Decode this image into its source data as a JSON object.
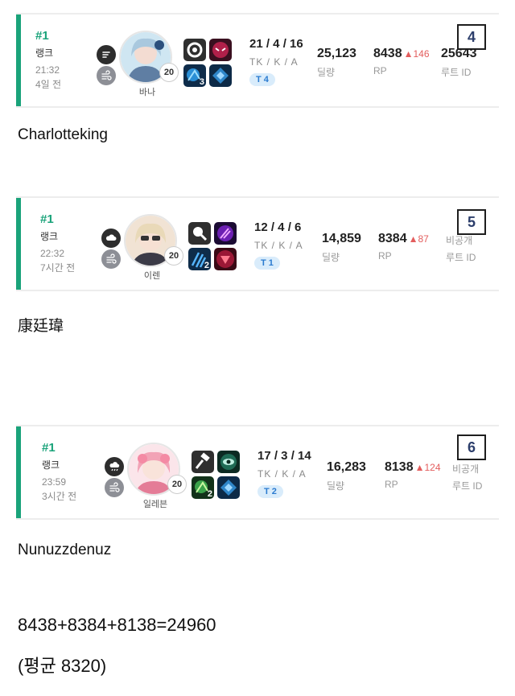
{
  "cards": [
    {
      "index": "4",
      "rank": "#1",
      "rank_label": "랭크",
      "time": "21:32",
      "ago": "4일 전",
      "weather_icons": [
        "wind-flag-icon",
        "haze-icon"
      ],
      "character": "바나",
      "level": "20",
      "items": [
        "gear-ring-icon",
        "demon-mask-icon",
        "blue-burst-icon",
        "blue-diamond-icon"
      ],
      "item_stack": "3",
      "kda": "21 / 4 / 16",
      "kda_label": "TK / K / A",
      "tier": "T 4",
      "damage": "25,123",
      "damage_label": "딜량",
      "rp": "8438",
      "rp_delta": "▲146",
      "rp_label": "RP",
      "root_id": "25643",
      "root_label": "루트 ID",
      "caption": "Charlotteking"
    },
    {
      "index": "5",
      "rank": "#1",
      "rank_label": "랭크",
      "time": "22:32",
      "ago": "7시간 전",
      "weather_icons": [
        "cloud-icon",
        "haze-icon"
      ],
      "character": "이렌",
      "level": "20",
      "items": [
        "magnifier-icon",
        "purple-spark-icon",
        "blue-claw-icon",
        "red-triangle-icon"
      ],
      "item_stack": "2",
      "kda": "12 / 4 / 6",
      "kda_label": "TK / K / A",
      "tier": "T 1",
      "damage": "14,859",
      "damage_label": "딜량",
      "rp": "8384",
      "rp_delta": "▲87",
      "rp_label": "RP",
      "root_id": "비공개",
      "root_label": "루트 ID",
      "caption": "康廷瑋"
    },
    {
      "index": "6",
      "rank": "#1",
      "rank_label": "랭크",
      "time": "23:59",
      "ago": "3시간 전",
      "weather_icons": [
        "rain-cloud-icon",
        "haze-icon"
      ],
      "character": "일레븐",
      "level": "20",
      "items": [
        "hammer-icon",
        "green-eye-icon",
        "green-burst-icon",
        "blue-diamond-icon"
      ],
      "item_stack": "2",
      "kda": "17 / 3 / 14",
      "kda_label": "TK / K / A",
      "tier": "T 2",
      "damage": "16,283",
      "damage_label": "딜량",
      "rp": "8138",
      "rp_delta": "▲124",
      "rp_label": "RP",
      "root_id": "비공개",
      "root_label": "루트 ID",
      "caption": "Nunuzzdenuz"
    }
  ],
  "summary": {
    "sum_line": "8438+8384+8138=24960",
    "avg_line": "(평균 8320)"
  },
  "colors": {
    "accent": "#1aa37a",
    "delta_red": "#e35d5d",
    "tier_bg": "#d9ecfb",
    "tier_text": "#2b7bd0"
  }
}
